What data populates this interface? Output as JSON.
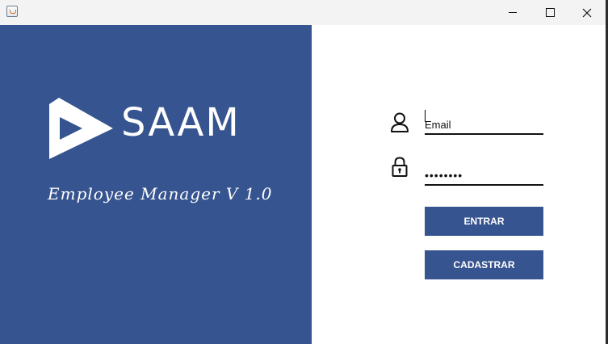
{
  "window": {
    "icon": "java-cup-icon",
    "controls": {
      "minimize_icon": "minimize-icon",
      "maximize_icon": "maximize-icon",
      "close_icon": "close-icon"
    }
  },
  "brand": {
    "name": "SAAM",
    "subtitle": "Employee Manager V 1.0",
    "logo_icon": "saam-arrow-logo",
    "panel_color": "#36548f"
  },
  "form": {
    "email": {
      "placeholder": "Email",
      "value": "",
      "icon": "user-icon"
    },
    "password": {
      "value": "12345678",
      "icon": "lock-icon"
    },
    "enter_label": "ENTRAR",
    "register_label": "CADASTRAR"
  }
}
